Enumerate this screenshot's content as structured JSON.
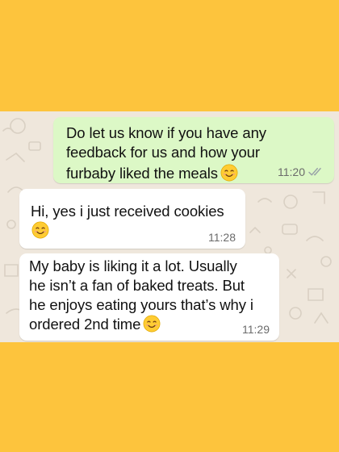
{
  "messages": {
    "outgoing": {
      "line1": "Do let us know if you have any",
      "line2": "feedback for us and how your",
      "line3": "furbaby liked the meals",
      "time": "11:20"
    },
    "incoming1": {
      "text": "Hi, yes i just received cookies",
      "time": "11:28"
    },
    "incoming2": {
      "line1": "My baby is liking it a lot. Usually",
      "line2": "he isn’t a fan of baked treats. But",
      "line3": "he enjoys eating yours that’s why i",
      "line4": "ordered 2nd time",
      "time": "11:29"
    }
  },
  "icons": {
    "emoji": "smiling-face-icon",
    "read_receipt": "double-check-icon"
  },
  "colors": {
    "background": "#FDC43D",
    "chat_background": "#EFE7DC",
    "outgoing_bubble": "#DCF8C6",
    "incoming_bubble": "#FFFFFF",
    "read_ticks": "#9AA3A8"
  }
}
